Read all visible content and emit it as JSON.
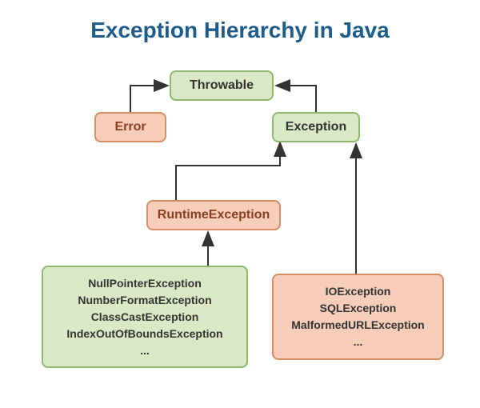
{
  "title": "Exception Hierarchy in Java",
  "nodes": {
    "throwable": "Throwable",
    "error": "Error",
    "exception": "Exception",
    "runtime": "RuntimeException"
  },
  "runtime_children": {
    "l1": "NullPointerException",
    "l2": "NumberFormatException",
    "l3": "ClassCastException",
    "l4": "IndexOutOfBoundsException",
    "l5": "..."
  },
  "checked_children": {
    "l1": "IOException",
    "l2": "SQLException",
    "l3": "MalformedURLException",
    "l4": "..."
  }
}
